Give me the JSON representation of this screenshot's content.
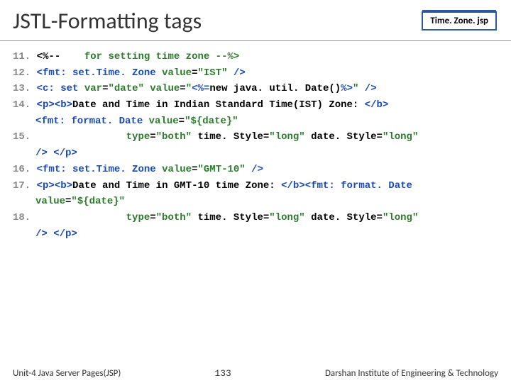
{
  "header": {
    "title": "JSTL-Formatting tags",
    "badge": "Time. Zone. jsp"
  },
  "lines": {
    "n11": "11.",
    "l11a": "<%--",
    "l11b": "for setting time zone --%>",
    "n12": "12.",
    "l12a": "<fmt: set.Time. Zone ",
    "l12b": "value",
    "l12c": "=",
    "l12d": "\"IST\" ",
    "l12e": "/>",
    "n13": "13.",
    "l13a": "<c: set ",
    "l13b": "var",
    "l13c": "=",
    "l13d": "\"date\" ",
    "l13e": "value",
    "l13f": "=",
    "l13g": "\"",
    "l13h": "<%=",
    "l13i": "new java. util. Date()",
    "l13j": "%>",
    "l13k": "\" ",
    "l13l": "/>",
    "n14": "14.",
    "l14a": "<p><b>",
    "l14b": "Date and Time in Indian Standard Time(IST) Zone: ",
    "l14c": "</b>",
    "l14d": "<fmt: format. Date ",
    "l14e": "value",
    "l14f": "=",
    "l14g": "\"${date}\"",
    "n15": "15.",
    "l15a": "type",
    "l15b": "=",
    "l15c": "\"both\" ",
    "l15d": "time. Style",
    "l15e": "=",
    "l15f": "\"long\" ",
    "l15g": "date. Style",
    "l15h": "=",
    "l15i": "\"long\" ",
    "l15j": "/> </p>",
    "n16": "16.",
    "l16a": "<fmt: set.Time. Zone ",
    "l16b": "value",
    "l16c": "=",
    "l16d": "\"GMT-10\" ",
    "l16e": "/>",
    "n17": "17.",
    "l17a": "<p><b>",
    "l17b": "Date and Time in GMT-10 time Zone: ",
    "l17c": "</b>",
    "l17d": "<fmt: format. Date",
    "l17e": "value",
    "l17f": "=",
    "l17g": "\"${date}\"",
    "n18": "18.",
    "l18a": "type",
    "l18b": "=",
    "l18c": "\"both\" ",
    "l18d": "time. Style",
    "l18e": "=",
    "l18f": "\"long\" ",
    "l18g": "date. Style",
    "l18h": "=",
    "l18i": "\"long\" ",
    "l18j": "/> </p>"
  },
  "footer": {
    "left": "Unit-4 Java Server Pages(JSP)",
    "page": "133",
    "right": "Darshan Institute of Engineering & Technology"
  }
}
